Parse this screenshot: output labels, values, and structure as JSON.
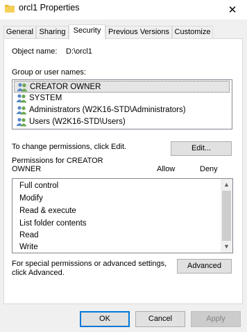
{
  "window": {
    "title": "orcl1 Properties",
    "close_glyph": "✕"
  },
  "tabs": [
    {
      "label": "General"
    },
    {
      "label": "Sharing"
    },
    {
      "label": "Security"
    },
    {
      "label": "Previous Versions"
    },
    {
      "label": "Customize"
    }
  ],
  "security": {
    "object_name_label": "Object name:",
    "object_name_value": "D:\\orcl1",
    "group_label": "Group or user names:",
    "users": [
      {
        "name": "CREATOR OWNER",
        "selected": true
      },
      {
        "name": "SYSTEM",
        "selected": false
      },
      {
        "name": "Administrators (W2K16-STD\\Administrators)",
        "selected": false
      },
      {
        "name": "Users (W2K16-STD\\Users)",
        "selected": false
      }
    ],
    "change_text": "To change permissions, click Edit.",
    "edit_button": "Edit...",
    "permissions_for_line1": "Permissions for CREATOR",
    "permissions_for_line2": "OWNER",
    "allow_header": "Allow",
    "deny_header": "Deny",
    "permissions": [
      {
        "name": "Full control"
      },
      {
        "name": "Modify"
      },
      {
        "name": "Read & execute"
      },
      {
        "name": "List folder contents"
      },
      {
        "name": "Read"
      },
      {
        "name": "Write"
      }
    ],
    "special_text_line1": "For special permissions or advanced settings,",
    "special_text_line2": "click Advanced.",
    "advanced_button": "Advanced"
  },
  "footer": {
    "ok": "OK",
    "cancel": "Cancel",
    "apply": "Apply"
  },
  "colors": {
    "focus_border": "#0078d7",
    "selected_row": "#e5e5e5",
    "folder": "#e8b73a"
  }
}
